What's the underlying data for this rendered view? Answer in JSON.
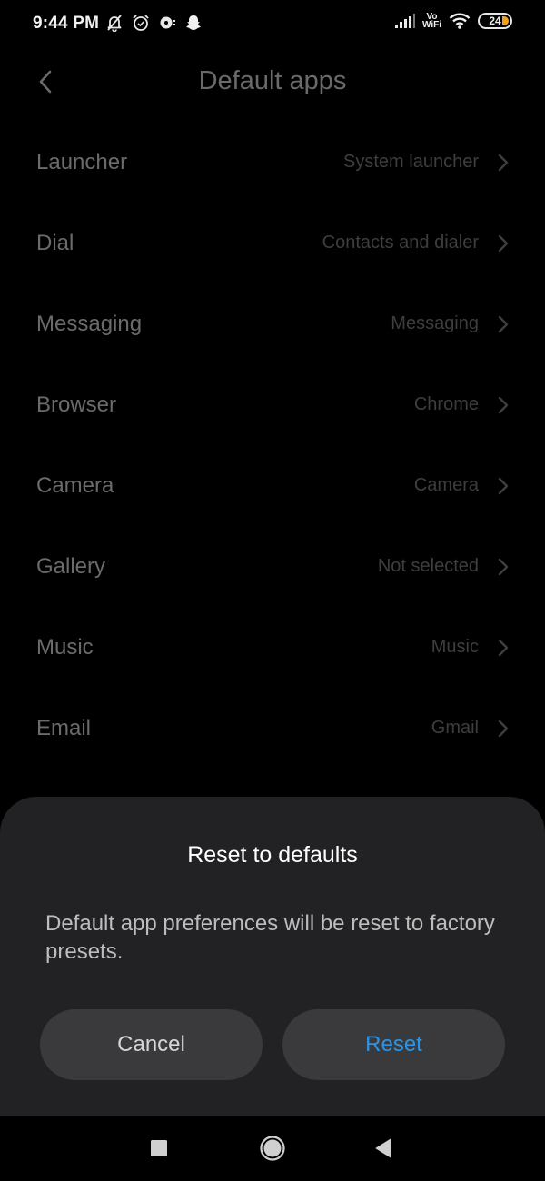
{
  "status_bar": {
    "time": "9:44 PM",
    "left_icons": [
      "bell-off-icon",
      "alarm-clock-icon",
      "notification-app-icon",
      "snapchat-ghost-icon"
    ],
    "right_icons": [
      "signal-strength-icon",
      "vowifi-icon",
      "wifi-icon",
      "battery-icon"
    ],
    "vowifi_label_top": "Vo",
    "vowifi_label_bottom": "WiFi",
    "battery_level": "24",
    "battery_accent": "#f0a020"
  },
  "header": {
    "back_icon": "chevron-left-icon",
    "title": "Default apps"
  },
  "list": {
    "items": [
      {
        "label": "Launcher",
        "value": "System launcher"
      },
      {
        "label": "Dial",
        "value": "Contacts and dialer"
      },
      {
        "label": "Messaging",
        "value": "Messaging"
      },
      {
        "label": "Browser",
        "value": "Chrome"
      },
      {
        "label": "Camera",
        "value": "Camera"
      },
      {
        "label": "Gallery",
        "value": "Not selected"
      },
      {
        "label": "Music",
        "value": "Music"
      },
      {
        "label": "Email",
        "value": "Gmail"
      }
    ]
  },
  "dialog": {
    "title": "Reset to defaults",
    "message": "Default app preferences will be reset to factory presets.",
    "cancel_label": "Cancel",
    "confirm_label": "Reset",
    "confirm_color": "#2a95e8"
  },
  "nav_bar": {
    "recents_icon": "square-recents-icon",
    "home_icon": "circle-home-icon",
    "back_icon": "triangle-back-icon"
  }
}
